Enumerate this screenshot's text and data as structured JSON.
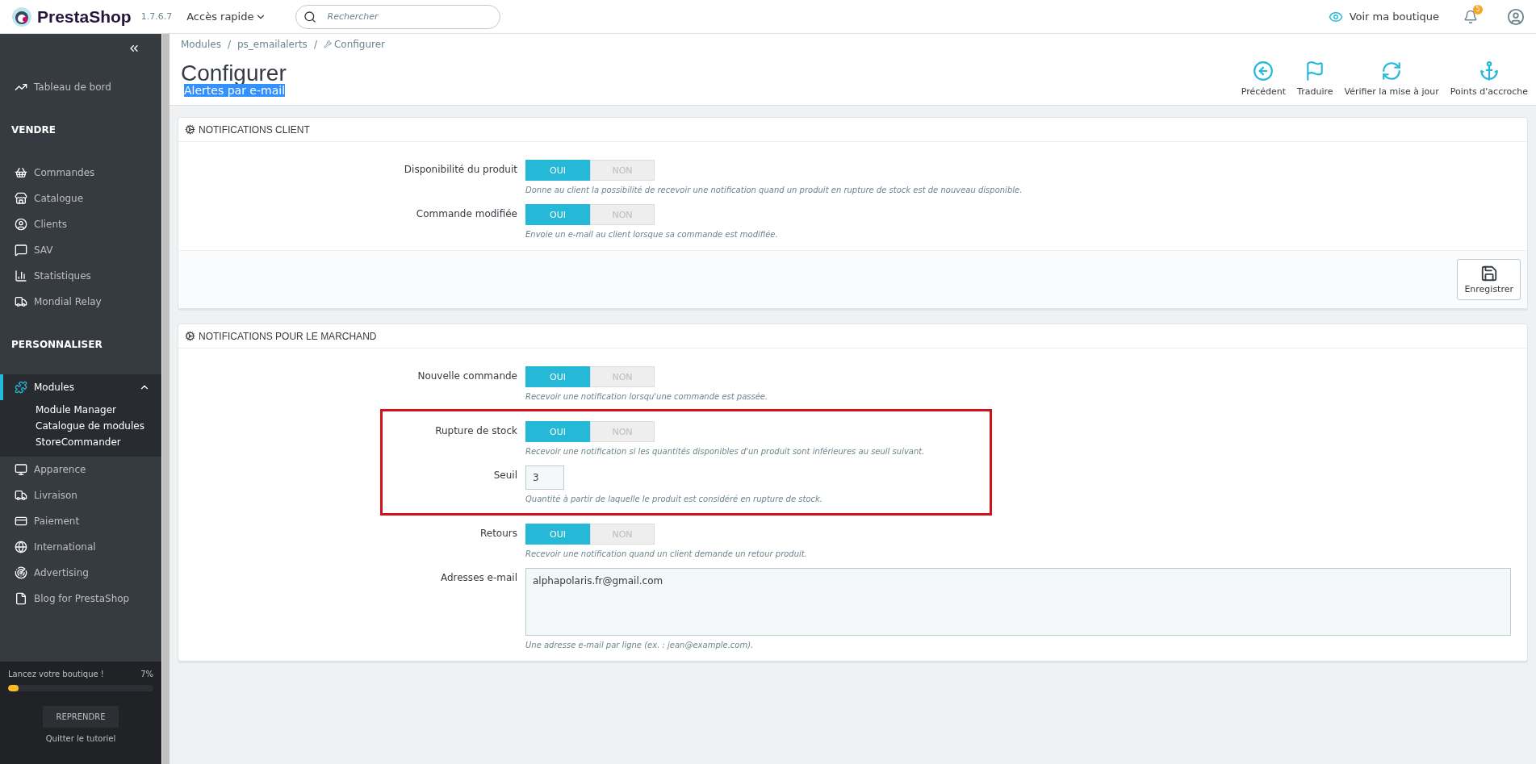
{
  "header": {
    "brand": "PrestaShop",
    "version": "1.7.6.7",
    "quick_access": "Accès rapide",
    "search": {
      "placeholder": "Rechercher"
    },
    "view_shop": "Voir ma boutique",
    "notifications": "5"
  },
  "sidebar": {
    "sections": [
      {
        "items": [
          {
            "label": "Tableau de bord",
            "selected": false,
            "expanded": false
          }
        ]
      },
      {
        "title": "VENDRE",
        "items": [
          {
            "label": "Commandes",
            "selected": false,
            "expanded": false
          },
          {
            "label": "Catalogue",
            "selected": false,
            "expanded": false
          },
          {
            "label": "Clients",
            "selected": false,
            "expanded": false
          },
          {
            "label": "SAV",
            "selected": false,
            "expanded": false
          },
          {
            "label": "Statistiques",
            "selected": false,
            "expanded": false
          },
          {
            "label": "Mondial Relay",
            "selected": false,
            "expanded": false
          }
        ]
      },
      {
        "title": "PERSONNALISER",
        "items": [
          {
            "label": "Modules",
            "selected": true,
            "expanded": true,
            "children": [
              {
                "label": "Module Manager"
              },
              {
                "label": "Catalogue de modules"
              },
              {
                "label": "StoreCommander"
              }
            ]
          },
          {
            "label": "Apparence",
            "selected": false,
            "expanded": false
          },
          {
            "label": "Livraison",
            "selected": false,
            "expanded": false
          },
          {
            "label": "Paiement",
            "selected": false,
            "expanded": false
          },
          {
            "label": "International",
            "selected": false,
            "expanded": false
          },
          {
            "label": "Advertising",
            "selected": false,
            "expanded": false
          },
          {
            "label": "Blog for PrestaShop",
            "selected": false,
            "expanded": false
          }
        ]
      }
    ],
    "onboarding": {
      "title": "Lancez votre boutique !",
      "percent": "7%",
      "level": 0.07,
      "resume": "REPRENDRE",
      "quit": "Quitter le tutoriel"
    }
  },
  "breadcrumb": [
    "Modules",
    "ps_emailalerts",
    "Configurer"
  ],
  "breadcrumb_separator": "/",
  "page": {
    "title": "Configurer",
    "subtitle": {
      "text": "Alertes par e-mail",
      "highlighted": true
    }
  },
  "toolbar": [
    "Précédent",
    "Traduire",
    "Vérifier la mise à jour",
    "Points d'accroche"
  ],
  "panels": [
    {
      "title": "NOTIFICATIONS CLIENT",
      "save": "Enregistrer",
      "rows": [
        {
          "kind": "switch",
          "label": "Disponibilité du produit",
          "yes": "OUI",
          "no": "NON",
          "on": true,
          "help": "Donne au client la possibilité de recevoir une notification quand un produit en rupture de stock est de nouveau disponible.",
          "highlighted": false
        },
        {
          "kind": "switch",
          "label": "Commande modifiée",
          "yes": "OUI",
          "no": "NON",
          "on": true,
          "help": "Envoie un e-mail au client lorsque sa commande est modifiée.",
          "highlighted": false
        }
      ]
    },
    {
      "title": "NOTIFICATIONS POUR LE MARCHAND",
      "rows": [
        {
          "kind": "switch",
          "label": "Nouvelle commande",
          "yes": "OUI",
          "no": "NON",
          "on": true,
          "help": "Recevoir une notification lorsqu'une commande est passée.",
          "highlighted": false
        },
        {
          "kind": "switch",
          "label": "Rupture de stock",
          "yes": "OUI",
          "no": "NON",
          "on": true,
          "help": "Recevoir une notification si les quantités disponibles d'un produit sont inférieures au seuil suivant.",
          "highlighted": true
        },
        {
          "kind": "number",
          "label": "Seuil",
          "value": "3",
          "help": "Quantité à partir de laquelle le produit est considéré en rupture de stock.",
          "highlighted": true
        },
        {
          "kind": "switch",
          "label": "Retours",
          "yes": "OUI",
          "no": "NON",
          "on": true,
          "help": "Recevoir une notification quand un client demande un retour produit.",
          "highlighted": false
        },
        {
          "kind": "textarea",
          "label": "Adresses e-mail",
          "value": "alphapolaris.fr@gmail.com",
          "help": "Une adresse e-mail par ligne (ex. : jean@example.com).",
          "highlighted": false
        }
      ]
    }
  ]
}
